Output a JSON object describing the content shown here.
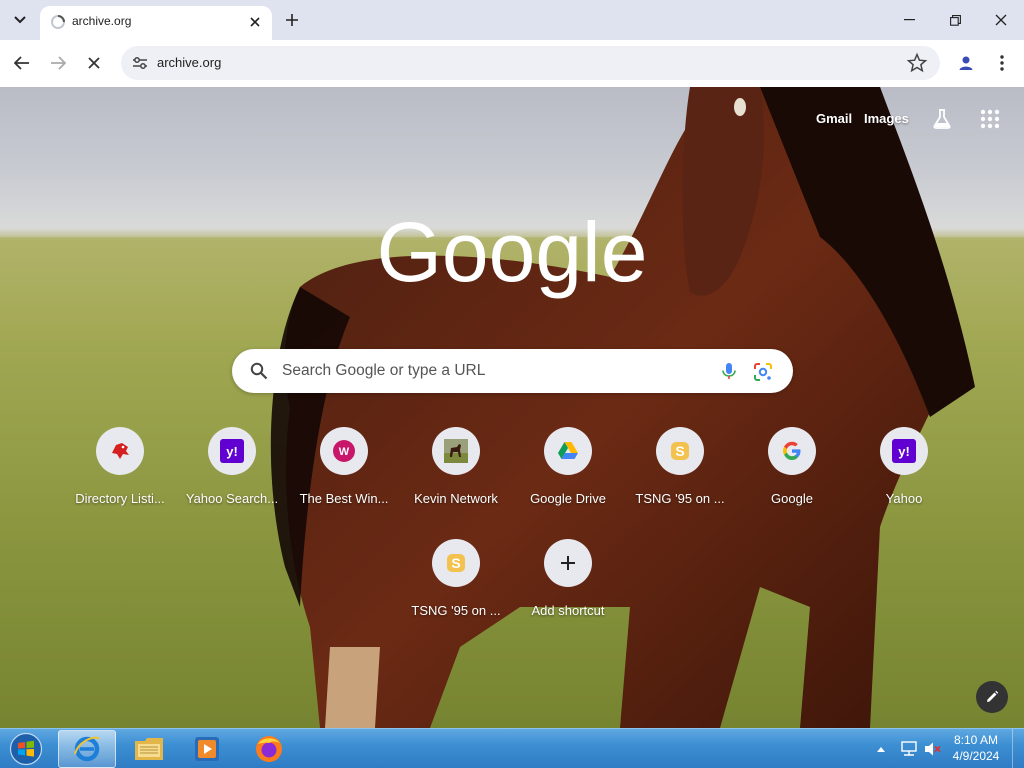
{
  "browser": {
    "tab": {
      "title": "archive.org"
    },
    "omnibox": {
      "url": "archive.org"
    }
  },
  "ntp": {
    "links": {
      "gmail": "Gmail",
      "images": "Images"
    },
    "logo_text": "Google",
    "search": {
      "placeholder": "Search Google or type a URL"
    },
    "shortcuts": [
      {
        "label": "Directory Listi...",
        "icon": "red-bird-icon"
      },
      {
        "label": "Yahoo Search...",
        "icon": "yahoo-icon"
      },
      {
        "label": "The Best Win...",
        "icon": "w-logo-icon"
      },
      {
        "label": "Kevin Network",
        "icon": "kevin-network-icon"
      },
      {
        "label": "Google Drive",
        "icon": "google-drive-icon"
      },
      {
        "label": "TSNG '95 on ...",
        "icon": "tsng-icon"
      },
      {
        "label": "Google",
        "icon": "google-g-icon"
      },
      {
        "label": "Yahoo",
        "icon": "yahoo-icon"
      },
      {
        "label": "TSNG '95 on ...",
        "icon": "tsng-icon"
      },
      {
        "label": "Add shortcut",
        "icon": "plus-icon"
      }
    ]
  },
  "taskbar": {
    "clock": {
      "time": "8:10 AM",
      "date": "4/9/2024"
    }
  },
  "colors": {
    "tabstrip": "#dfe3f0",
    "omnibox": "#eef0f6",
    "yahoo_purple": "#6001d2",
    "taskbar_blue": "#3d8fd3"
  }
}
